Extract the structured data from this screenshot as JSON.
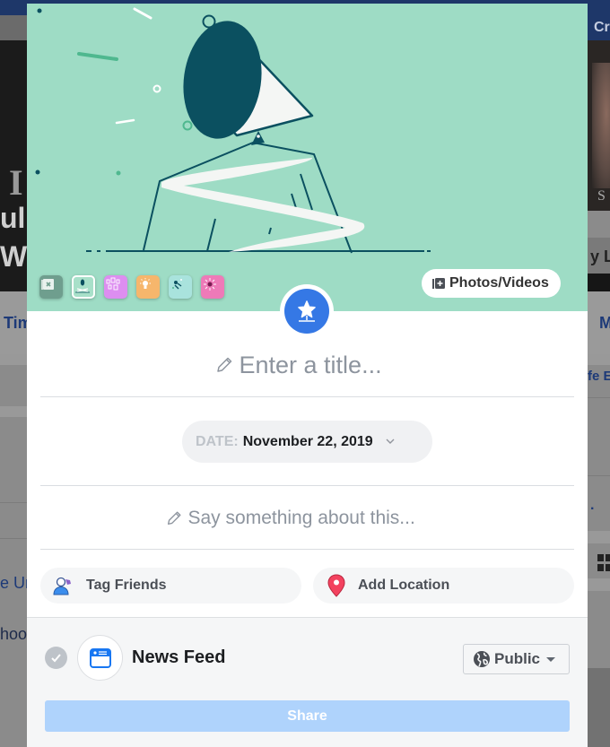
{
  "background_page": {
    "left_snippets": {
      "cover_letter": "I",
      "cover_line1": "ul",
      "cover_line2": "We",
      "tab": "Tim",
      "item1": "e Ur",
      "item2": "hoo"
    },
    "right_snippets": {
      "topbar": "Cr",
      "cover_caption": "S",
      "cover_name": "y Lo",
      "tab": "M",
      "item1": "fe E",
      "item2": "."
    }
  },
  "dialog": {
    "hero": {
      "templates": [
        {
          "name": "no-background",
          "color": "#6f9e8e",
          "selected": false
        },
        {
          "name": "megaphone",
          "color": "#a8e0c9",
          "selected": true
        },
        {
          "name": "frames",
          "color": "#dd8ef0",
          "selected": false
        },
        {
          "name": "lightbulb",
          "color": "#f6b66c",
          "selected": false
        },
        {
          "name": "sparkle-figure",
          "color": "#a9e3dd",
          "selected": false
        },
        {
          "name": "starburst",
          "color": "#ee7ab8",
          "selected": false
        }
      ],
      "photos_videos_label": "Photos/Videos",
      "hero_bg_color": "#9edcc5"
    },
    "badge_icon": "star-milestone-icon",
    "title_placeholder": "Enter a title...",
    "date": {
      "label": "DATE:",
      "value": "November 22, 2019"
    },
    "description_placeholder": "Say something about this...",
    "actions": {
      "tag_friends": "Tag Friends",
      "add_location": "Add Location"
    },
    "footer": {
      "destination_label": "News Feed",
      "destination_checked": true,
      "privacy_label": "Public",
      "share_label": "Share"
    },
    "colors": {
      "accent": "#3578e5",
      "share_disabled": "#afd3fc",
      "location_pin": "#f3425f"
    }
  }
}
